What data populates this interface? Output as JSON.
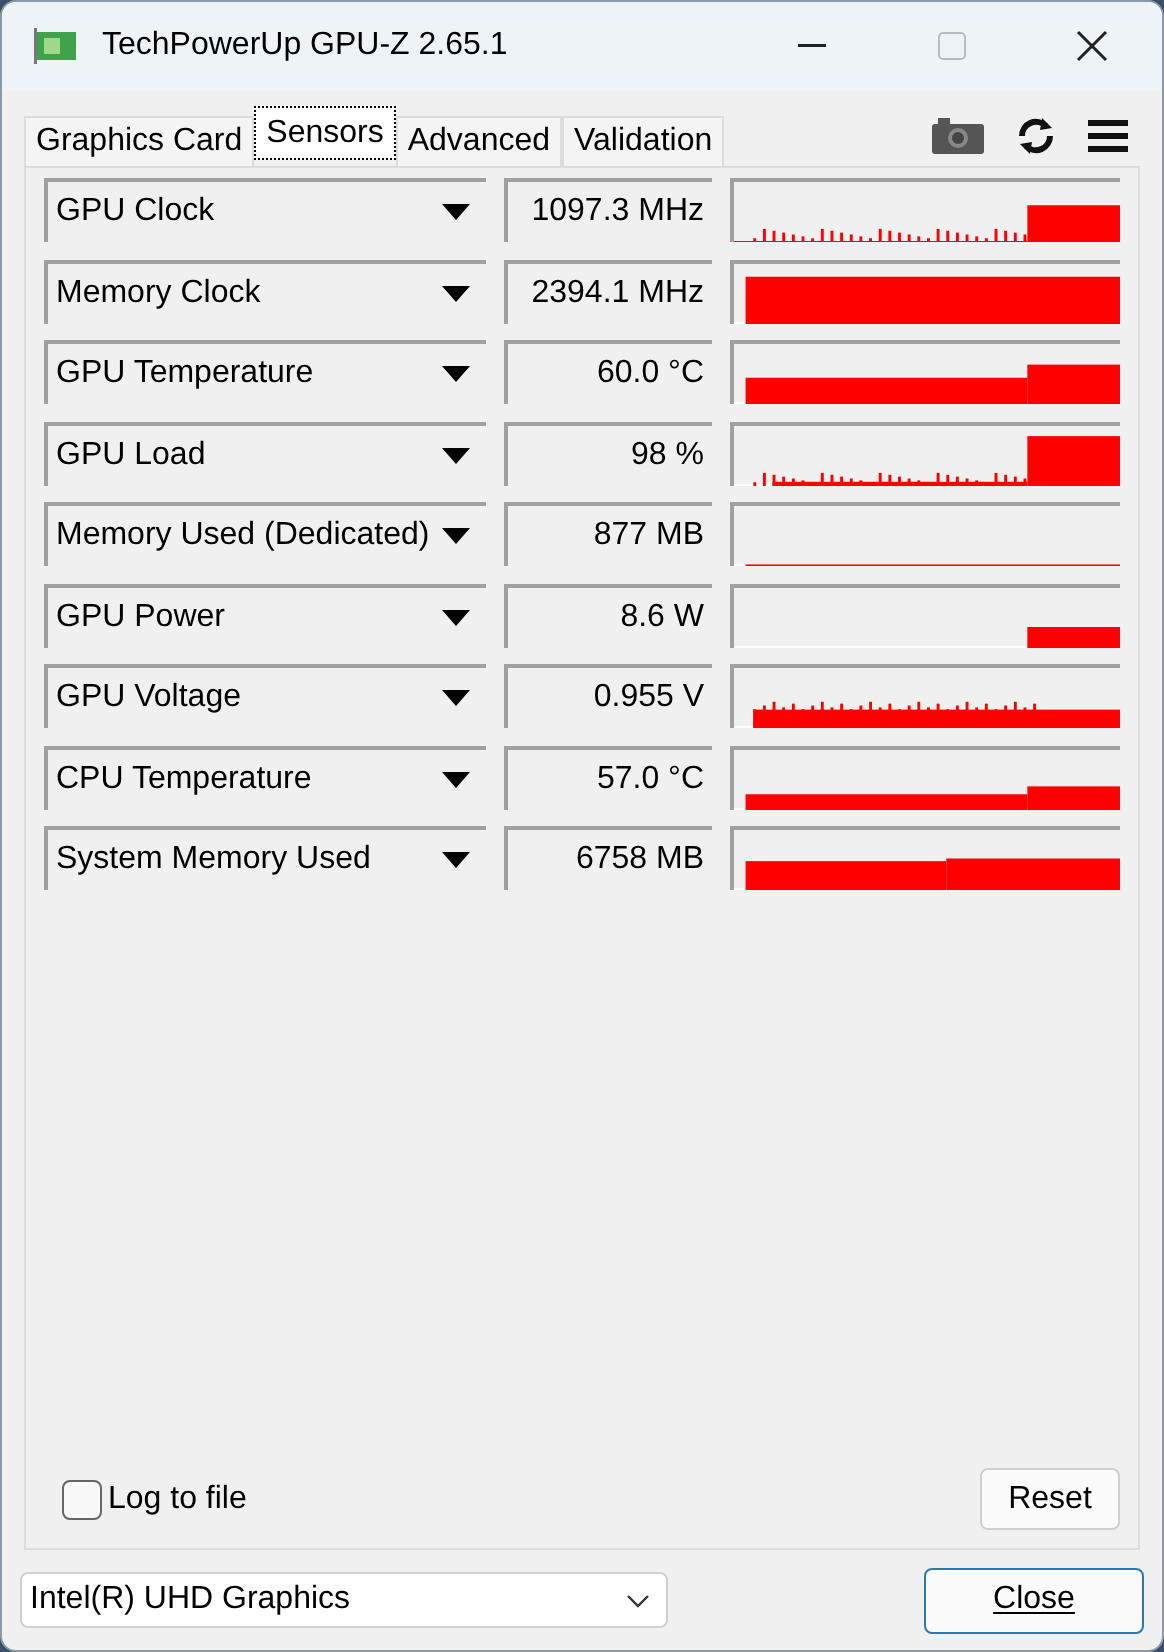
{
  "window": {
    "title": "TechPowerUp GPU-Z 2.65.1"
  },
  "tabs": [
    {
      "label": "Graphics Card",
      "selected": false
    },
    {
      "label": "Sensors",
      "selected": true
    },
    {
      "label": "Advanced",
      "selected": false
    },
    {
      "label": "Validation",
      "selected": false
    }
  ],
  "sensors": [
    {
      "name": "GPU Clock",
      "reading": "1097.3 MHz"
    },
    {
      "name": "Memory Clock",
      "reading": "2394.1 MHz"
    },
    {
      "name": "GPU Temperature",
      "reading": "60.0 °C"
    },
    {
      "name": "GPU Load",
      "reading": "98 %"
    },
    {
      "name": "Memory Used (Dedicated)",
      "reading": "877 MB"
    },
    {
      "name": "GPU Power",
      "reading": "8.6 W"
    },
    {
      "name": "GPU Voltage",
      "reading": "0.955 V"
    },
    {
      "name": "CPU Temperature",
      "reading": "57.0 °C"
    },
    {
      "name": "System Memory Used",
      "reading": "6758 MB"
    }
  ],
  "log_to_file": {
    "label": "Log to file",
    "checked": false
  },
  "reset_button": "Reset",
  "device_select": {
    "value": "Intel(R) UHD Graphics"
  },
  "close_button": "Close"
}
